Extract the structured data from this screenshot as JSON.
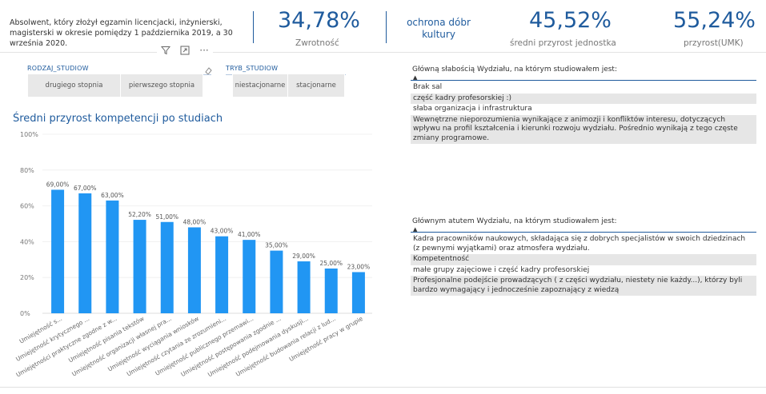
{
  "header": {
    "description": "Absolwent, który złożył egzamin licencjacki, inżynierski, magisterski w okresie pomiędzy 1 października 2019, a 30 września 2020.",
    "kpi_return": {
      "value": "34,78%",
      "label": "Zwrotność"
    },
    "discipline": "ochrona dóbr kultury",
    "kpi_unit": {
      "value": "45,52%",
      "label": "średni przyrost jednostka"
    },
    "kpi_umk": {
      "value": "55,24%",
      "label": "przyrost(UMK)"
    }
  },
  "visual_header": {
    "icons": [
      "filter-icon",
      "focus-mode-icon",
      "more-options-icon"
    ],
    "more": "···"
  },
  "slicers": {
    "rodzaj": {
      "title": "RODZAJ_STUDIOW",
      "options": [
        "drugiego stopnia",
        "pierwszego stopnia"
      ]
    },
    "tryb": {
      "title": "TRYB_STUDIOW",
      "options": [
        "niestacjonarne",
        "stacjonarne"
      ]
    }
  },
  "chart_title": "Średni przyrost kompetencji po studiach",
  "chart_data": {
    "type": "bar",
    "title": "Średni przyrost kompetencji po studiach",
    "categories": [
      "Umiejętność s...",
      "Umiejętność krytycznego ...",
      "Umiejętności praktyczne zgodne z w...",
      "Umiejętność pisania tekstów",
      "Umiejętność organizacji własnej pra...",
      "Umiejętność wyciągania wniosków",
      "Umiejętność czytania ze zrozumieni...",
      "Umiejętność publicznego przemawi...",
      "Umiejętność postępowania zgodnie ...",
      "Umiejętność podejmowania dyskusji...",
      "Umiejętność budowania relacji z lud...",
      "Umiejętność pracy w grupie"
    ],
    "values": [
      69,
      67,
      63,
      52.2,
      51,
      48,
      43,
      41,
      35,
      29,
      25,
      23
    ],
    "data_labels": [
      "69,00%",
      "67,00%",
      "63,00%",
      "52,20%",
      "51,00%",
      "48,00%",
      "43,00%",
      "41,00%",
      "35,00%",
      "29,00%",
      "25,00%",
      "23,00%"
    ],
    "yticks": [
      "0%",
      "20%",
      "40%",
      "60%",
      "80%",
      "100%"
    ],
    "ylim": [
      0,
      100
    ],
    "color": "#2196f3"
  },
  "weakness": {
    "header": "Główną słabością Wydziału, na którym studiowałem jest:",
    "sort_icon": "▲",
    "rows": [
      "Brak sal",
      "część kadry profesorskiej :)",
      "słaba organizacja i infrastruktura",
      "Wewnętrzne nieporozumienia wynikające z animozji i konfliktów interesu, dotyczących wpływu na profil kształcenia i kierunki rozwoju wydziału. Pośrednio wynikają z tego częste zmiany programowe."
    ]
  },
  "strength": {
    "header": "Głównym atutem Wydziału, na którym studiowałem jest:",
    "sort_icon": "▲",
    "rows": [
      "Kadra pracowników naukowych, składająca się z dobrych specjalistów w swoich dziedzinach (z pewnymi wyjątkami) oraz atmosfera wydziału.",
      "Kompetentność",
      "małe grupy zajęciowe i część kadry profesorskiej",
      "Profesjonalne podejście prowadzących ( z części wydziału, niestety nie każdy...), którzy byli bardzo wymagający i jednocześnie zapoznający z wiedzą"
    ]
  }
}
